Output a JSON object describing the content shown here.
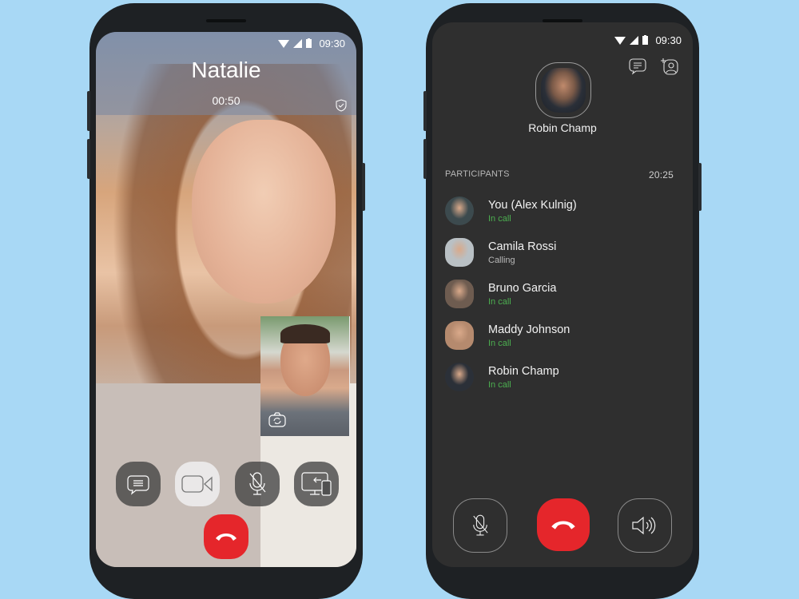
{
  "background_color": "#a8d8f5",
  "left_screen": {
    "status_bar": {
      "time": "09:30",
      "icons": [
        "wifi-icon",
        "signal-icon",
        "battery-icon"
      ]
    },
    "caller_name": "Natalie",
    "call_duration": "00:50",
    "encryption_icon": "shield-check-icon",
    "self_view": {
      "icon": "switch-camera-icon"
    },
    "controls": [
      {
        "name": "chat",
        "icon": "chat-bubble-icon",
        "state": "default"
      },
      {
        "name": "video",
        "icon": "video-camera-icon",
        "state": "active"
      },
      {
        "name": "mute",
        "icon": "mic-off-icon",
        "state": "default"
      },
      {
        "name": "transfer",
        "icon": "transfer-to-device-icon",
        "state": "default"
      }
    ],
    "end_call": {
      "icon": "phone-hangup-icon",
      "color": "#e5262b"
    }
  },
  "right_screen": {
    "status_bar": {
      "time": "09:30",
      "icons": [
        "wifi-icon",
        "signal-icon",
        "battery-icon"
      ]
    },
    "top_actions": [
      {
        "name": "chat",
        "icon": "chat-bubble-icon"
      },
      {
        "name": "add-participant",
        "icon": "add-user-icon"
      }
    ],
    "active_speaker": "Robin Champ",
    "participants_label": "PARTICIPANTS",
    "call_duration": "20:25",
    "participants": [
      {
        "name": "You (Alex Kulnig)",
        "status": "In call",
        "status_color": "#4caf50",
        "avatar_color": "#3c4a4e"
      },
      {
        "name": "Camila Rossi",
        "status": "Calling",
        "status_color": "#b8b8b8",
        "avatar_color": "#b9c0c4"
      },
      {
        "name": "Bruno Garcia",
        "status": "In call",
        "status_color": "#4caf50",
        "avatar_color": "#6e5c50"
      },
      {
        "name": "Maddy Johnson",
        "status": "In call",
        "status_color": "#4caf50",
        "avatar_color": "#b58a6e"
      },
      {
        "name": "Robin Champ",
        "status": "In call",
        "status_color": "#4caf50",
        "avatar_color": "#2b3038"
      }
    ],
    "controls": [
      {
        "name": "mute",
        "icon": "mic-off-icon"
      },
      {
        "name": "end-call",
        "icon": "phone-hangup-icon",
        "color": "#e5262b"
      },
      {
        "name": "speaker",
        "icon": "speaker-icon"
      }
    ]
  }
}
